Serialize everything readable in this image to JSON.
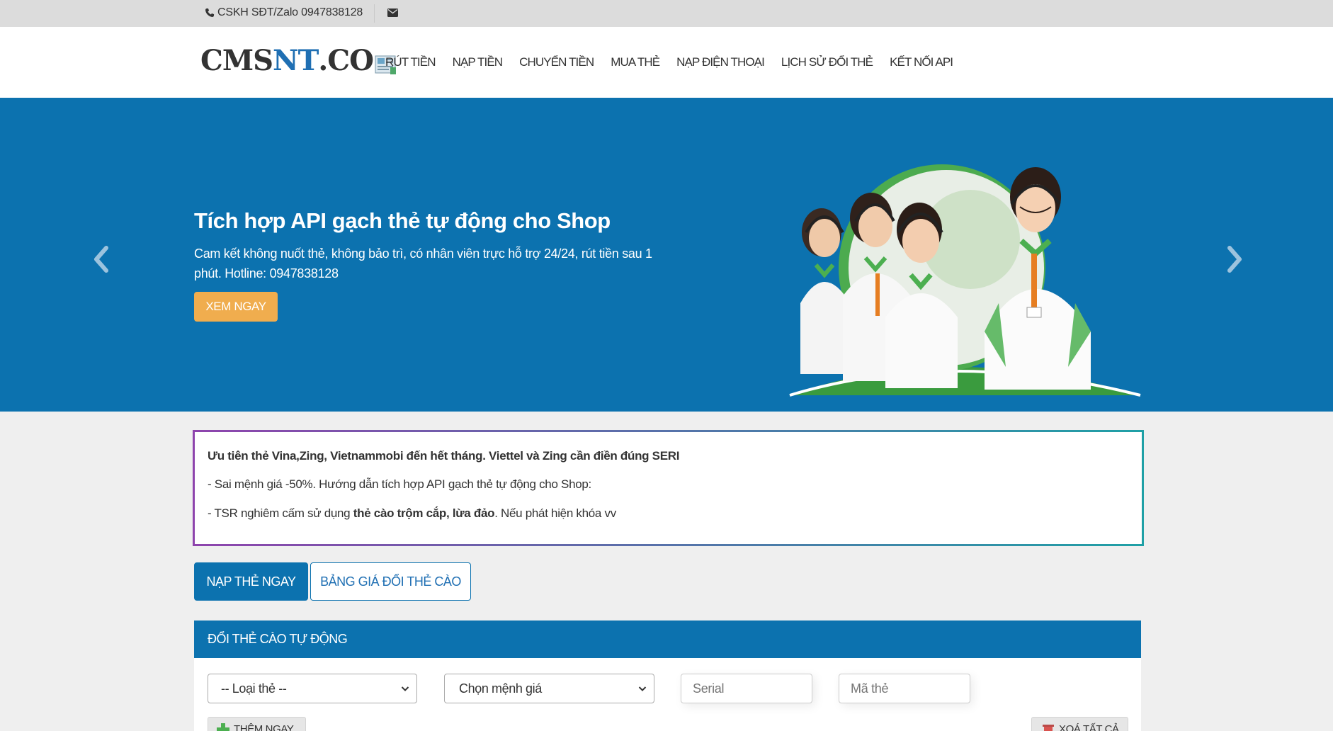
{
  "topbar": {
    "contact_text": "CSKH SĐT/Zalo 0947838128",
    "phone_icon": "phone-icon",
    "mail_icon": "envelope-icon"
  },
  "header": {
    "logo_prefix": "CMS",
    "logo_highlight": "NT",
    "logo_suffix": ".CO",
    "nav": [
      "RÚT TIỀN",
      "NẠP TIỀN",
      "CHUYỂN TIỀN",
      "MUA THẺ",
      "NẠP ĐIỆN THOẠI",
      "LỊCH SỬ ĐỔI THẺ",
      "KẾT NỐI API"
    ]
  },
  "hero": {
    "title": "Tích hợp API gạch thẻ tự động cho Shop",
    "description": "Cam kết không nuốt thẻ, không bảo trì, có nhân viên trực hỗ trợ 24/24, rút tiền sau 1 phút. Hotline: 0947838128",
    "cta_label": "XEM NGAY",
    "prev_icon": "chevron-left-icon",
    "next_icon": "chevron-right-icon"
  },
  "notice": {
    "line1": "Ưu tiên thẻ Vina,Zing, Vietnammobi đến hết tháng. Viettel và Zing cần điền đúng SERI",
    "line2": "- Sai mệnh giá -50%. Hướng dẫn tích hợp API gạch thẻ tự động cho Shop:",
    "line3_prefix": "- TSR nghiêm cấm sử dụng ",
    "line3_bold": "thẻ cào trộm cắp, lừa đảo",
    "line3_suffix": ". Nếu phát hiện khóa vv"
  },
  "tabs": {
    "active": "NẠP THẺ NGAY",
    "inactive": "BẢNG GIÁ ĐỔI THẺ CÀO"
  },
  "form": {
    "panel_title": "ĐỔI THẺ CÀO TỰ ĐỘNG",
    "card_type_selected": "-- Loại thẻ --",
    "amount_selected": "Chọn mệnh giá",
    "serial_placeholder": "Serial",
    "code_placeholder": "Mã thẻ",
    "add_label": "THÊM NGAY",
    "clear_label": "XOÁ TẤT CẢ"
  },
  "colors": {
    "brand_blue": "#0c72af",
    "cta_orange": "#f0ad4e",
    "topbar_gray": "#dcdcdc"
  }
}
